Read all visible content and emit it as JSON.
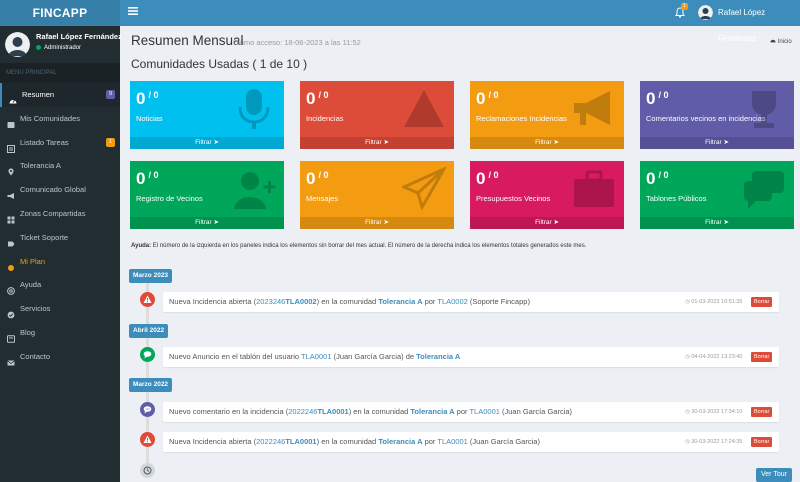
{
  "app": {
    "logo": "FINCAPP"
  },
  "topbar": {
    "notifications_count": "1",
    "user_name": "Rafael López Fernández"
  },
  "sidebar": {
    "user_name": "Rafael López Fernández",
    "user_role": "Administrador",
    "menu_header": "MENU PRINCIPAL",
    "items": [
      {
        "label": "Resumen",
        "icon": "dashboard-icon",
        "badge": "9",
        "badge_color": "#605ca8"
      },
      {
        "label": "Mis Comunidades",
        "icon": "users-icon"
      },
      {
        "label": "Listado Tareas",
        "icon": "list-icon",
        "badge": "1",
        "badge_color": "#f39c12"
      },
      {
        "label": "Tolerancia A",
        "icon": "map-marker-icon"
      },
      {
        "label": "Comunicado Global",
        "icon": "megaphone-icon"
      },
      {
        "label": "Zonas Compartidas",
        "icon": "grid-icon"
      },
      {
        "label": "Ticket Soporte",
        "icon": "ticket-icon"
      },
      {
        "label": "Mi Plan",
        "icon": "plan-icon"
      },
      {
        "label": "Ayuda",
        "icon": "help-icon"
      },
      {
        "label": "Servicios",
        "icon": "services-icon"
      },
      {
        "label": "Blog",
        "icon": "blog-icon"
      },
      {
        "label": "Contacto",
        "icon": "mail-icon"
      }
    ]
  },
  "header": {
    "title": "Resumen Mensual",
    "subtitle": "Ultimo acceso: 18-06-2023 a las 11:52",
    "breadcrumb": "Inicio",
    "section_title": "Comunidades Usadas ( 1 de 10 )"
  },
  "boxes": [
    {
      "num": "0",
      "total": "/ 0",
      "label": "Noticias",
      "footer": "Filtrar",
      "color": "#00c0ef",
      "icon": "microphone-icon"
    },
    {
      "num": "0",
      "total": "/ 0",
      "label": "Incidencias",
      "footer": "Filtrar",
      "color": "#dd4b39",
      "icon": "warning-icon"
    },
    {
      "num": "0",
      "total": "/ 0",
      "label": "Reclamaciones Incidencias",
      "footer": "Filtrar",
      "color": "#f39c12",
      "icon": "bullhorn-icon"
    },
    {
      "num": "0",
      "total": "/ 0",
      "label": "Comentarios vecinos en incidencias",
      "footer": "Filtrar",
      "color": "#605ca8",
      "icon": "trophy-icon"
    },
    {
      "num": "0",
      "total": "/ 0",
      "label": "Registro de Vecinos",
      "footer": "Filtrar",
      "color": "#00a65a",
      "icon": "user-plus-icon"
    },
    {
      "num": "0",
      "total": "/ 0",
      "label": "Mensajes",
      "footer": "Filtrar",
      "color": "#f39c12",
      "icon": "paper-plane-icon"
    },
    {
      "num": "0",
      "total": "/ 0",
      "label": "Presupuestos Vecinos",
      "footer": "Filtrar",
      "color": "#d81b60",
      "icon": "briefcase-icon"
    },
    {
      "num": "0",
      "total": "/ 0",
      "label": "Tablones Públicos",
      "footer": "Filtrar",
      "color": "#00a65a",
      "icon": "comments-icon"
    }
  ],
  "help": {
    "label": "Ayuda:",
    "text": "El número de la izquierda en los paneles indica los elementos sin borrar del mes actual. El número de la derecha indica los elementos totales generados este mes."
  },
  "timeline": {
    "labels": [
      "Marzo 2023",
      "Abril 2022",
      "Marzo 2022"
    ],
    "items": [
      {
        "icon": "warning-icon",
        "icon_color": "#dd4b39",
        "p1": "Nueva Incidencia abierta (",
        "code": "2023246",
        "codeb": "TLA0002",
        "p2": ") en la comunidad ",
        "community": "Tolerancia A",
        "p3": " por ",
        "user": "TLA0002",
        "p4": " (Soporte Fincapp)",
        "time": "01-03-2023 10:51:35",
        "action": "Borrar"
      },
      {
        "icon": "comment-icon",
        "icon_color": "#00a65a",
        "p1": "Nuevo Anuncio en el tablón del usuario ",
        "user": "TLA0001",
        "p2": " (Juan García Garcia) de ",
        "community": "Tolerancia A",
        "time": "04-04-2022 13:23:40",
        "action": "Borrar"
      },
      {
        "icon": "comment-dots-icon",
        "icon_color": "#605ca8",
        "p1": "Nuevo comentario en la incidencia (",
        "code": "2022246",
        "codeb": "TLA0001",
        "p2": ") en la comunidad ",
        "community": "Tolerancia A",
        "p3": " por ",
        "user": "TLA0001",
        "p4": " (Juan García Garcia)",
        "time": "30-03-2022 17:34:10",
        "action": "Borrar"
      },
      {
        "icon": "warning-icon",
        "icon_color": "#dd4b39",
        "p1": "Nueva Incidencia abierta (",
        "code": "2022246",
        "codeb": "TLA0001",
        "p2": ") en la comunidad ",
        "community": "Tolerancia A",
        "p3": " por ",
        "user": "TLA0001",
        "p4": " (Juan García Garcia)",
        "time": "30-03-2022 17:24:35",
        "action": "Borrar"
      }
    ],
    "tour_button": "Ver Tour"
  }
}
